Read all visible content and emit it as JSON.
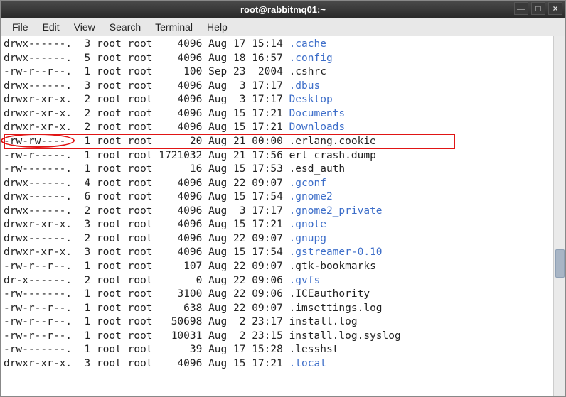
{
  "window": {
    "title": "root@rabbitmq01:~"
  },
  "menubar": {
    "items": [
      "File",
      "Edit",
      "View",
      "Search",
      "Terminal",
      "Help"
    ]
  },
  "listing": {
    "rows": [
      {
        "perms": "drwx------.",
        "links": "3",
        "owner": "root",
        "group": "root",
        "size": "4096",
        "month": "Aug",
        "day": "17",
        "time": "15:14",
        "name": ".cache",
        "dir": true
      },
      {
        "perms": "drwx------.",
        "links": "5",
        "owner": "root",
        "group": "root",
        "size": "4096",
        "month": "Aug",
        "day": "18",
        "time": "16:57",
        "name": ".config",
        "dir": true
      },
      {
        "perms": "-rw-r--r--.",
        "links": "1",
        "owner": "root",
        "group": "root",
        "size": "100",
        "month": "Sep",
        "day": "23",
        "time": "2004",
        "name": ".cshrc",
        "dir": false
      },
      {
        "perms": "drwx------.",
        "links": "3",
        "owner": "root",
        "group": "root",
        "size": "4096",
        "month": "Aug",
        "day": "3",
        "time": "17:17",
        "name": ".dbus",
        "dir": true
      },
      {
        "perms": "drwxr-xr-x.",
        "links": "2",
        "owner": "root",
        "group": "root",
        "size": "4096",
        "month": "Aug",
        "day": "3",
        "time": "17:17",
        "name": "Desktop",
        "dir": true
      },
      {
        "perms": "drwxr-xr-x.",
        "links": "2",
        "owner": "root",
        "group": "root",
        "size": "4096",
        "month": "Aug",
        "day": "15",
        "time": "17:21",
        "name": "Documents",
        "dir": true
      },
      {
        "perms": "drwxr-xr-x.",
        "links": "2",
        "owner": "root",
        "group": "root",
        "size": "4096",
        "month": "Aug",
        "day": "15",
        "time": "17:21",
        "name": "Downloads",
        "dir": true
      },
      {
        "perms": "-rw-rw----",
        "links": "1",
        "owner": "root",
        "group": "root",
        "size": "20",
        "month": "Aug",
        "day": "21",
        "time": "00:00",
        "name": ".erlang.cookie",
        "dir": false,
        "highlighted": true
      },
      {
        "perms": "-rw-r-----.",
        "links": "1",
        "owner": "root",
        "group": "root",
        "size": "1721032",
        "month": "Aug",
        "day": "21",
        "time": "17:56",
        "name": "erl_crash.dump",
        "dir": false
      },
      {
        "perms": "-rw-------.",
        "links": "1",
        "owner": "root",
        "group": "root",
        "size": "16",
        "month": "Aug",
        "day": "15",
        "time": "17:53",
        "name": ".esd_auth",
        "dir": false
      },
      {
        "perms": "drwx------.",
        "links": "4",
        "owner": "root",
        "group": "root",
        "size": "4096",
        "month": "Aug",
        "day": "22",
        "time": "09:07",
        "name": ".gconf",
        "dir": true
      },
      {
        "perms": "drwx------.",
        "links": "6",
        "owner": "root",
        "group": "root",
        "size": "4096",
        "month": "Aug",
        "day": "15",
        "time": "17:54",
        "name": ".gnome2",
        "dir": true
      },
      {
        "perms": "drwx------.",
        "links": "2",
        "owner": "root",
        "group": "root",
        "size": "4096",
        "month": "Aug",
        "day": "3",
        "time": "17:17",
        "name": ".gnome2_private",
        "dir": true
      },
      {
        "perms": "drwxr-xr-x.",
        "links": "3",
        "owner": "root",
        "group": "root",
        "size": "4096",
        "month": "Aug",
        "day": "15",
        "time": "17:21",
        "name": ".gnote",
        "dir": true
      },
      {
        "perms": "drwx------.",
        "links": "2",
        "owner": "root",
        "group": "root",
        "size": "4096",
        "month": "Aug",
        "day": "22",
        "time": "09:07",
        "name": ".gnupg",
        "dir": true
      },
      {
        "perms": "drwxr-xr-x.",
        "links": "3",
        "owner": "root",
        "group": "root",
        "size": "4096",
        "month": "Aug",
        "day": "15",
        "time": "17:54",
        "name": ".gstreamer-0.10",
        "dir": true
      },
      {
        "perms": "-rw-r--r--.",
        "links": "1",
        "owner": "root",
        "group": "root",
        "size": "107",
        "month": "Aug",
        "day": "22",
        "time": "09:07",
        "name": ".gtk-bookmarks",
        "dir": false
      },
      {
        "perms": "dr-x------.",
        "links": "2",
        "owner": "root",
        "group": "root",
        "size": "0",
        "month": "Aug",
        "day": "22",
        "time": "09:06",
        "name": ".gvfs",
        "dir": true
      },
      {
        "perms": "-rw-------.",
        "links": "1",
        "owner": "root",
        "group": "root",
        "size": "3100",
        "month": "Aug",
        "day": "22",
        "time": "09:06",
        "name": ".ICEauthority",
        "dir": false
      },
      {
        "perms": "-rw-r--r--.",
        "links": "1",
        "owner": "root",
        "group": "root",
        "size": "638",
        "month": "Aug",
        "day": "22",
        "time": "09:07",
        "name": ".imsettings.log",
        "dir": false
      },
      {
        "perms": "-rw-r--r--.",
        "links": "1",
        "owner": "root",
        "group": "root",
        "size": "50698",
        "month": "Aug",
        "day": "2",
        "time": "23:17",
        "name": "install.log",
        "dir": false
      },
      {
        "perms": "-rw-r--r--.",
        "links": "1",
        "owner": "root",
        "group": "root",
        "size": "10031",
        "month": "Aug",
        "day": "2",
        "time": "23:15",
        "name": "install.log.syslog",
        "dir": false
      },
      {
        "perms": "-rw-------.",
        "links": "1",
        "owner": "root",
        "group": "root",
        "size": "39",
        "month": "Aug",
        "day": "17",
        "time": "15:28",
        "name": ".lesshst",
        "dir": false
      },
      {
        "perms": "drwxr-xr-x.",
        "links": "3",
        "owner": "root",
        "group": "root",
        "size": "4096",
        "month": "Aug",
        "day": "15",
        "time": "17:21",
        "name": ".local",
        "dir": true
      }
    ]
  }
}
